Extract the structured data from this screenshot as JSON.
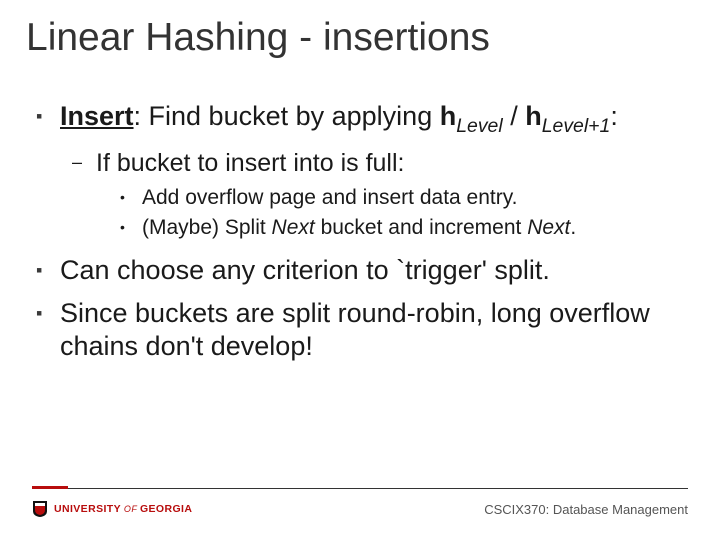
{
  "title": "Linear Hashing - insertions",
  "bullets": {
    "p1_lead": "Insert",
    "p1_a": ":  Find bucket by applying ",
    "p1_h1": "h",
    "p1_sub1": "Level",
    "p1_slash": " / ",
    "p1_h2": "h",
    "p1_sub2": "Level+1",
    "p1_colon": ":",
    "p2": "If bucket to insert into is full:",
    "p3a": "Add overflow page and insert data entry.",
    "p3b_a": "(Maybe) Split ",
    "p3b_i1": "Next",
    "p3b_b": " bucket and increment ",
    "p3b_i2": "Next",
    "p3b_c": ".",
    "p4": "Can choose any criterion to `trigger' split.",
    "p5": "Since buckets are split round-robin, long overflow chains don't develop!"
  },
  "footer": {
    "uni_a": "UNIVERSITY",
    "uni_of": " OF ",
    "uni_b": "GEORGIA",
    "course": "CSCIX370: Database Management"
  }
}
